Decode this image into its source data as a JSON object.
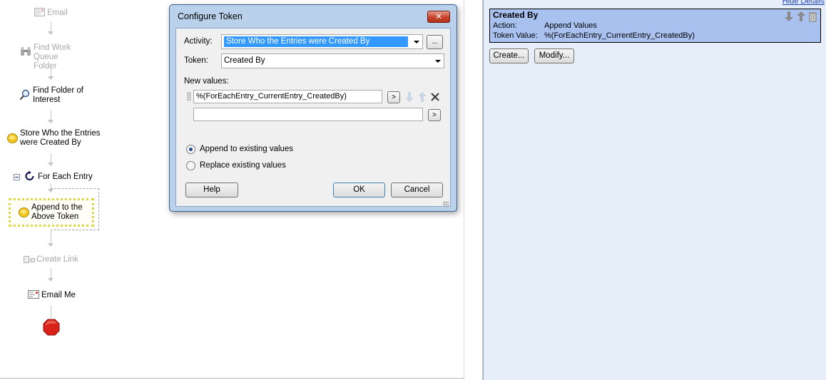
{
  "workflow": {
    "nodes": [
      {
        "label": "Email",
        "dim": true
      },
      {
        "label": "Find Work Queue Folder",
        "dim": true
      },
      {
        "label": "Find Folder of Interest",
        "dim": false
      },
      {
        "label": "Store Who the Entries were Created By",
        "dim": false
      },
      {
        "label": "For Each Entry",
        "dim": false
      },
      {
        "label": "Append to the Above Token",
        "dim": false
      },
      {
        "label": "Create Link",
        "dim": true
      },
      {
        "label": "Email Me",
        "dim": false
      }
    ]
  },
  "dialog": {
    "title": "Configure Token",
    "close_label": "✕",
    "activity_label": "Activity:",
    "activity_value": "Store Who the Entries were Created By",
    "browse_label": "...",
    "token_label": "Token:",
    "token_value": "Created By",
    "new_values_label": "New values:",
    "value_1": "%(ForEachEntry_CurrentEntry_CreatedBy)",
    "value_2": "",
    "insert_label": ">",
    "append_option": "Append to existing values",
    "replace_option": "Replace existing values",
    "selected_option": "append",
    "help_label": "Help",
    "ok_label": "OK",
    "cancel_label": "Cancel"
  },
  "details": {
    "hide_details": "Hide Details",
    "card_title": "Created By",
    "action_key": "Action:",
    "action_value": "Append Values",
    "token_value_key": "Token Value:",
    "token_value": "%(ForEachEntry_CurrentEntry_CreatedBy)",
    "create_label": "Create...",
    "modify_label": "Modify..."
  },
  "colors": {
    "selection_highlight": "#3399ff",
    "card_background": "#a9c1ef",
    "panel_background": "#e6eef9",
    "selected_node_border": "#e8e05a",
    "stop_red": "#d9231a"
  }
}
